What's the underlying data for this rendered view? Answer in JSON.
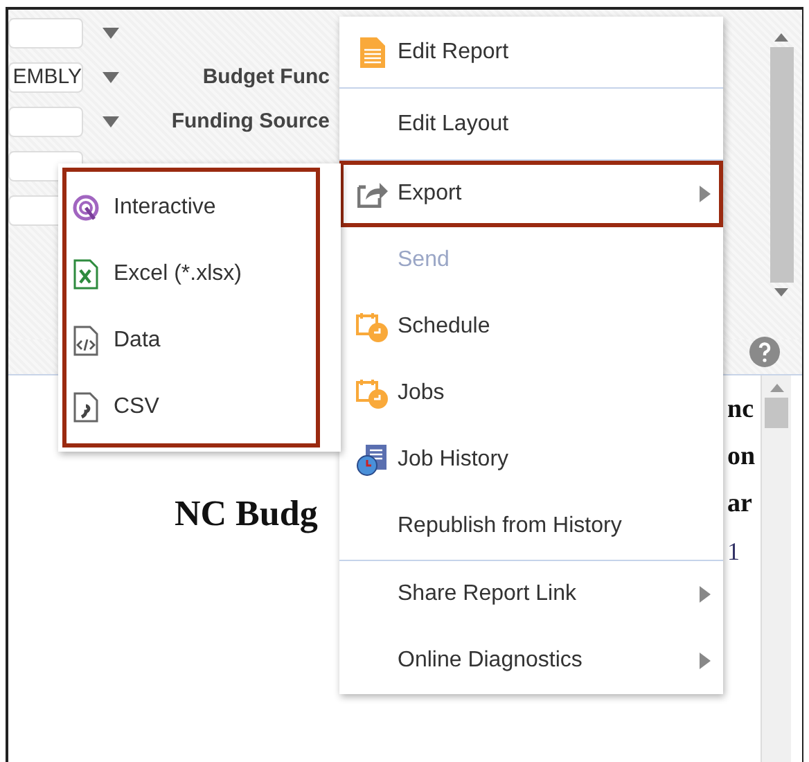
{
  "parameters": {
    "fields": [
      {
        "dropdown": true
      },
      {
        "value": "EMBLY",
        "dropdown": true,
        "label": "Budget Func"
      },
      {
        "dropdown": true,
        "label": "Funding Source"
      }
    ]
  },
  "report": {
    "title": "NC Budg",
    "fragments": [
      "nc",
      "on",
      "ar",
      "1"
    ]
  },
  "menu": {
    "groups": [
      [
        {
          "label": "Edit Report",
          "disabled": false,
          "submenu": false,
          "highlighted": false
        }
      ],
      [
        {
          "label": "Edit Layout",
          "disabled": false,
          "submenu": false,
          "highlighted": false
        }
      ],
      [
        {
          "label": "Export",
          "disabled": false,
          "submenu": true,
          "highlighted": true
        },
        {
          "label": "Send",
          "disabled": true,
          "submenu": false,
          "highlighted": false
        },
        {
          "label": "Schedule",
          "disabled": false,
          "submenu": false,
          "highlighted": false
        },
        {
          "label": "Jobs",
          "disabled": false,
          "submenu": false,
          "highlighted": false
        },
        {
          "label": "Job History",
          "disabled": false,
          "submenu": false,
          "highlighted": false
        },
        {
          "label": "Republish from History",
          "disabled": false,
          "submenu": false,
          "highlighted": false
        }
      ],
      [
        {
          "label": "Share Report Link",
          "disabled": false,
          "submenu": true,
          "highlighted": false
        },
        {
          "label": "Online Diagnostics",
          "disabled": false,
          "submenu": true,
          "highlighted": false
        }
      ]
    ]
  },
  "submenu": {
    "highlighted": true,
    "items": [
      {
        "label": "Interactive"
      },
      {
        "label": "Excel (*.xlsx)"
      },
      {
        "label": "Data"
      },
      {
        "label": "CSV"
      }
    ]
  }
}
